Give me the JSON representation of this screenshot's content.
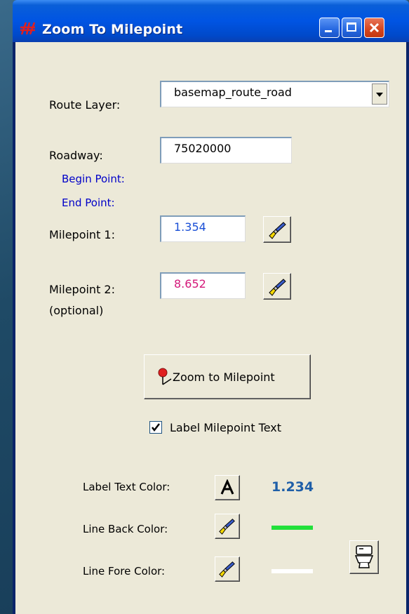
{
  "window": {
    "title": "Zoom To Milepoint"
  },
  "form": {
    "route_layer_label": "Route Layer:",
    "route_layer_value": "basemap_route_road",
    "roadway_label": "Roadway:",
    "roadway_value": "75020000",
    "begin_point_label": "Begin Point:",
    "end_point_label": "End Point:",
    "milepoint1_label": "Milepoint 1:",
    "milepoint1_value": "1.354",
    "milepoint2_label": "Milepoint 2:",
    "milepoint2_optional": "(optional)",
    "milepoint2_value": "8.652",
    "zoom_button_label": "Zoom to Milepoint",
    "label_checkbox_label": "Label Milepoint Text",
    "label_checkbox_checked": true
  },
  "colors": {
    "label_text_color_label": "Label Text Color:",
    "label_text_sample": "1.234",
    "label_text_color": "#1f5fa8",
    "line_back_color_label": "Line Back Color:",
    "line_back_color": "#22e03a",
    "line_fore_color_label": "Line Fore Color:",
    "line_fore_color": "#ffffff",
    "milepoint1_color": "#1a4fd6",
    "milepoint2_color": "#d4187a"
  },
  "icons": {
    "title": "milepoint-app-icon",
    "pick": "paintbrush-icon",
    "font": "font-A-icon",
    "zoom": "map-pin-icon",
    "clear": "toilet-icon"
  }
}
